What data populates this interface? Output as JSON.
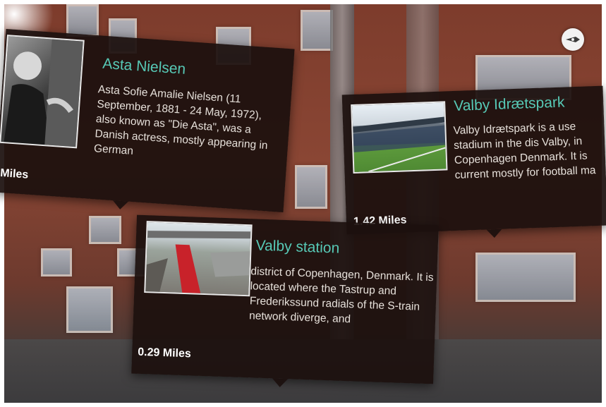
{
  "cards": {
    "asta": {
      "title": "Asta Nielsen",
      "description": "Asta Sofie Amalie Nielsen (11 September, 1881 - 24 May, 1972), also known as \"Die Asta\", was a Danish actress, mostly appearing in German",
      "distance": "Miles"
    },
    "valby_park": {
      "title": "Valby Idrætspark",
      "description": "Valby Idrætspark is a use stadium in the dis Valby, in Copenhagen Denmark. It is current mostly for football ma",
      "distance": "1.42 Miles"
    },
    "station": {
      "title": "Valby station",
      "description": "district of Copenhagen, Denmark. It is located where the Tastrup and Frederikssund radials of the S-train network diverge, and",
      "distance": "0.29 Miles"
    }
  },
  "icons": {
    "compass": "compass-icon"
  },
  "colors": {
    "title": "#57c9b6",
    "card_bg": "#1c100e",
    "text": "#e6e0da"
  }
}
